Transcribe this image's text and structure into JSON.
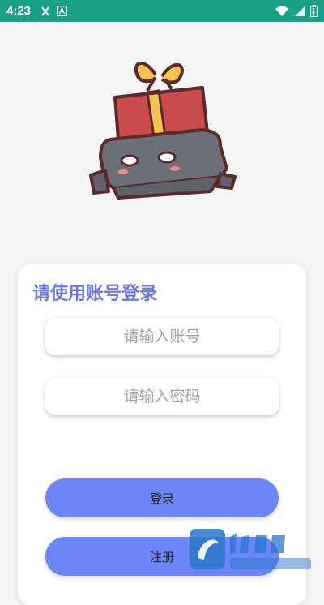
{
  "status_bar": {
    "time": "4:23",
    "left_icons": [
      "bug-icon",
      "a-box-icon"
    ],
    "right_icons": [
      "wifi-icon",
      "signal-icon",
      "battery-icon"
    ],
    "color": "#1aa085"
  },
  "login": {
    "title": "请使用账号登录",
    "account_placeholder": "请输入账号",
    "password_placeholder": "请输入密码",
    "login_label": "登录",
    "register_label": "注册",
    "accent": "#6d86f7"
  }
}
